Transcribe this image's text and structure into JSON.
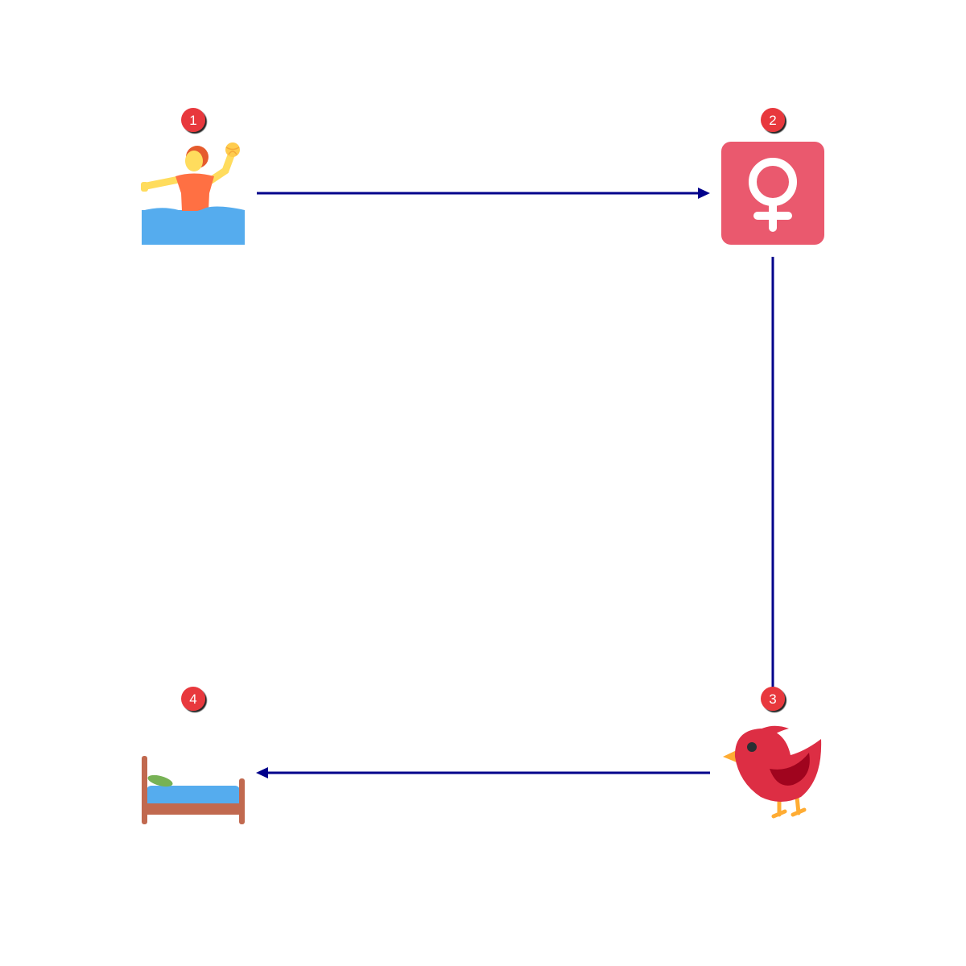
{
  "diagram": {
    "type": "flow-cycle",
    "colors": {
      "background": "#ffffff",
      "connector": "#00008b",
      "badge": "#e8383d",
      "badge_text": "#ffffff"
    },
    "nodes": [
      {
        "step": "1",
        "icon": "water-polo-player-icon"
      },
      {
        "step": "2",
        "icon": "female-sign-icon"
      },
      {
        "step": "3",
        "icon": "red-bird-icon"
      },
      {
        "step": "4",
        "icon": "bed-icon"
      }
    ],
    "edges": [
      {
        "from": "1",
        "to": "2",
        "arrow": true
      },
      {
        "from": "2",
        "to": "3",
        "arrow": false
      },
      {
        "from": "3",
        "to": "4",
        "arrow": true
      }
    ]
  }
}
